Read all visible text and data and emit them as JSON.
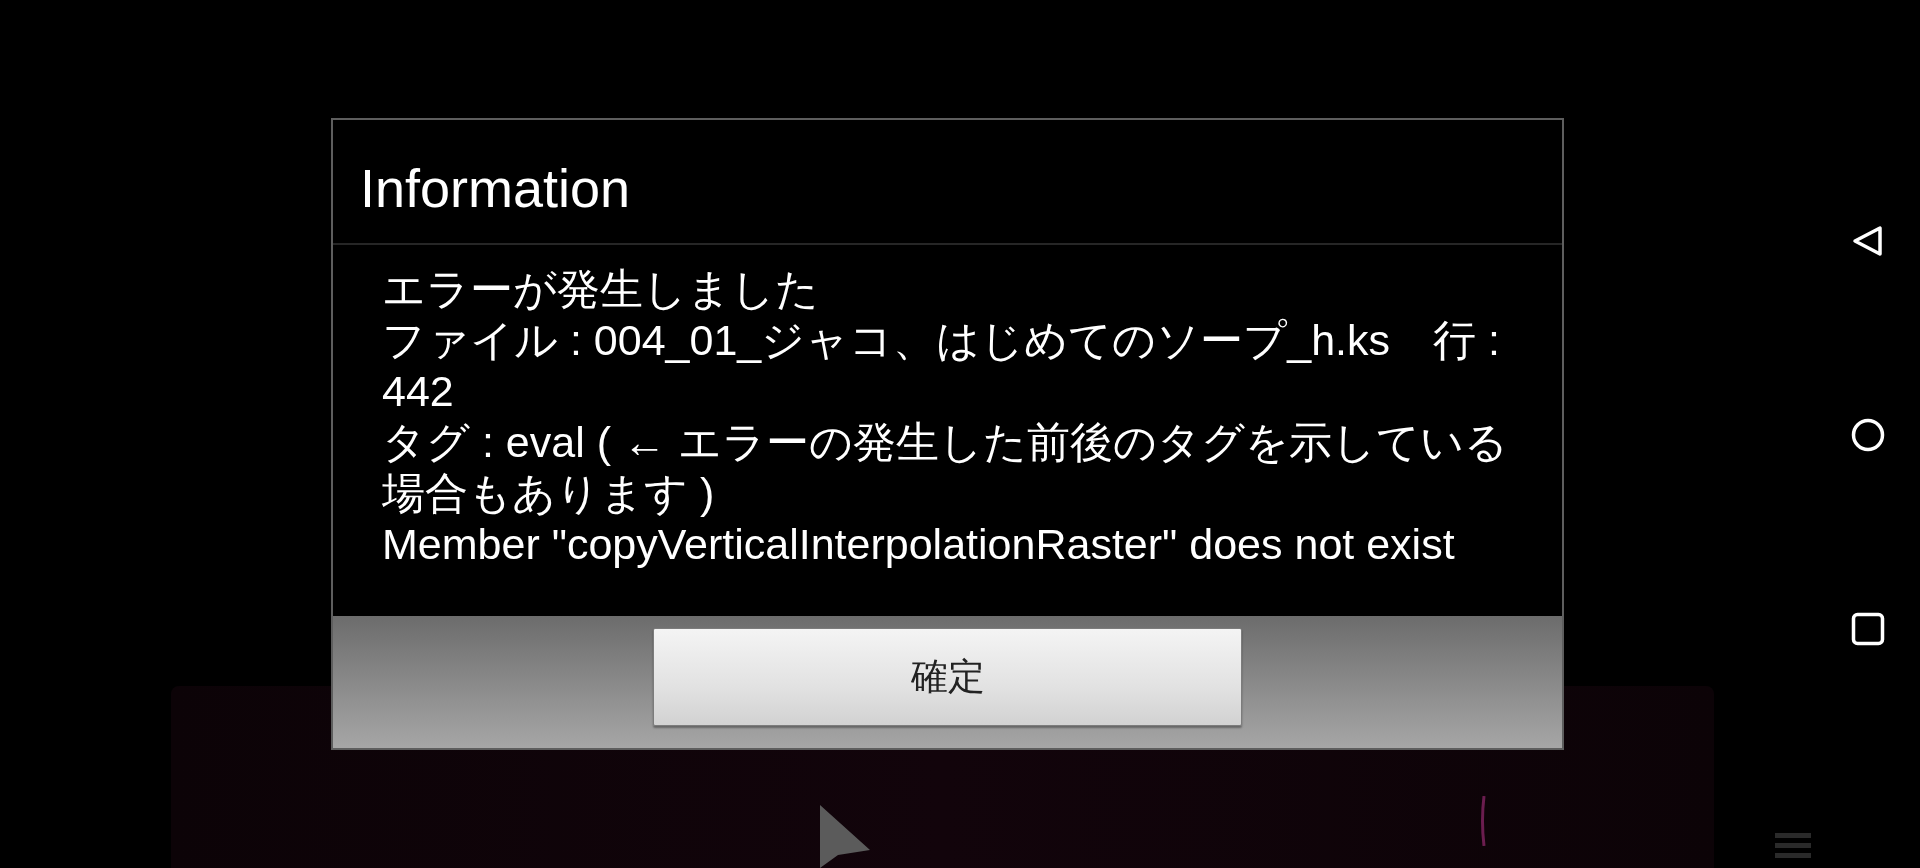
{
  "dialog": {
    "title": "Information",
    "message": [
      "エラーが発生しました",
      "ファイル : 004_01_ジャコ、はじめてのソープ_h.ks　行 : 442",
      "タグ : eval ( ← エラーの発生した前後のタグを示している場合もあります )",
      "Member \"copyVerticalInterpolationRaster\" does not exist"
    ],
    "buttons": [
      "確定"
    ]
  }
}
